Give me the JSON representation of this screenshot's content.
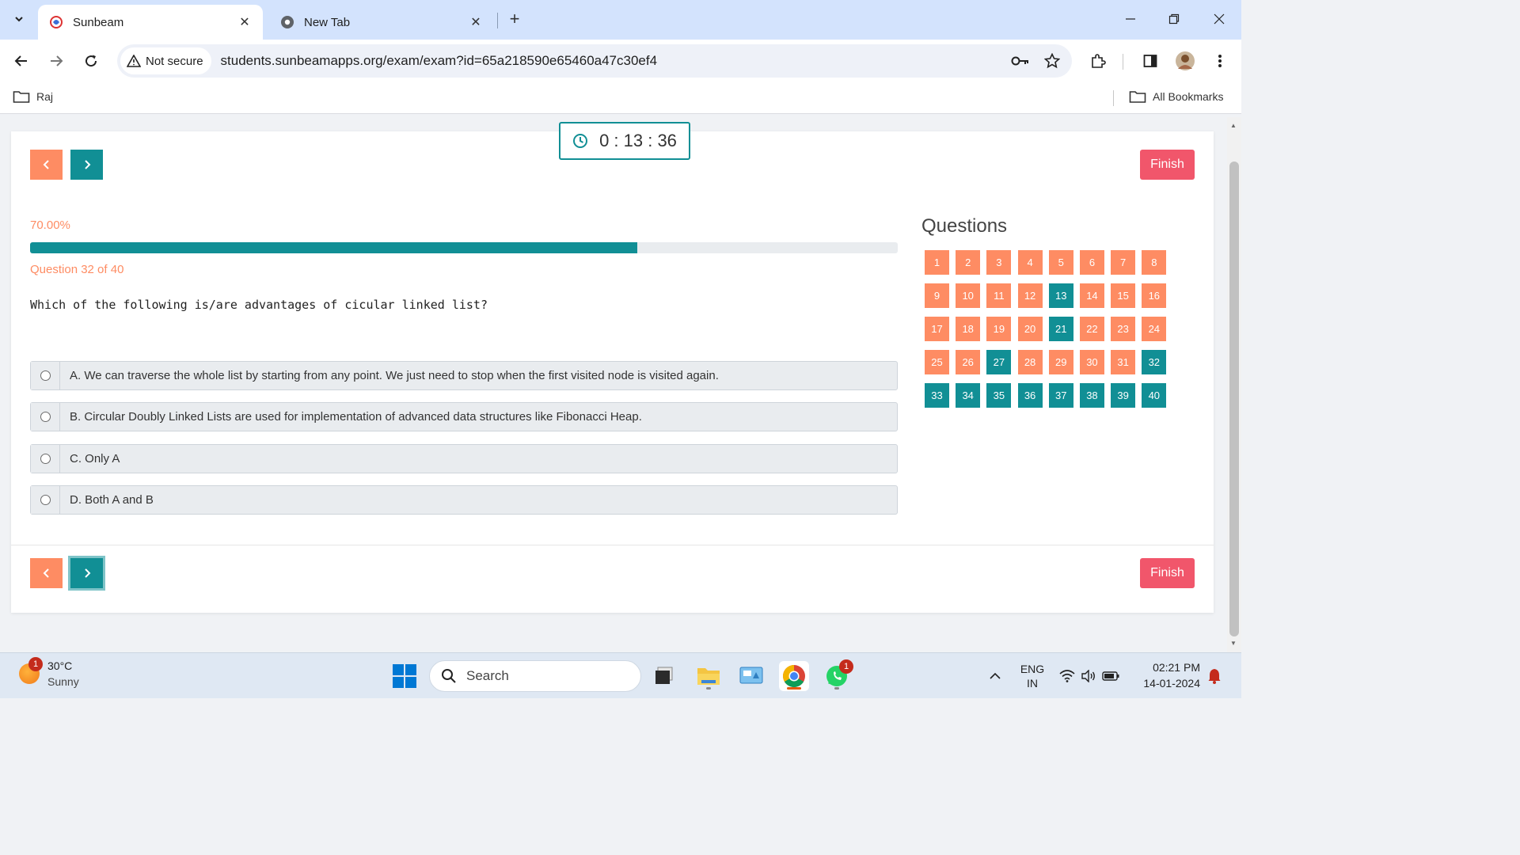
{
  "browser": {
    "tabs": [
      {
        "title": "Sunbeam",
        "active": true
      },
      {
        "title": "New Tab",
        "active": false
      }
    ],
    "security_label": "Not secure",
    "url": "students.sunbeamapps.org/exam/exam?id=65a218590e65460a47c30ef4",
    "bookmarks": {
      "left": "Raj",
      "right": "All Bookmarks"
    }
  },
  "exam": {
    "timer": "0 : 13 : 36",
    "finish_label": "Finish",
    "progress_text": "70.00%",
    "progress_value": 0.7,
    "question_counter": "Question 32 of 40",
    "question_text": "Which of the following is/are advantages of cicular linked list?",
    "options": [
      {
        "text": "A.  We can traverse the whole list by starting from any point. We just need to stop when the first visited node is visited again."
      },
      {
        "text": "B.  Circular Doubly Linked Lists are used for implementation of advanced data structures like Fibonacci Heap."
      },
      {
        "text": "C. Only A"
      },
      {
        "text": "D. Both A and B"
      }
    ],
    "questions_title": "Questions",
    "questions": [
      {
        "n": "1",
        "s": "u"
      },
      {
        "n": "2",
        "s": "u"
      },
      {
        "n": "3",
        "s": "u"
      },
      {
        "n": "4",
        "s": "u"
      },
      {
        "n": "5",
        "s": "u"
      },
      {
        "n": "6",
        "s": "u"
      },
      {
        "n": "7",
        "s": "u"
      },
      {
        "n": "8",
        "s": "u"
      },
      {
        "n": "9",
        "s": "u"
      },
      {
        "n": "10",
        "s": "u"
      },
      {
        "n": "11",
        "s": "u"
      },
      {
        "n": "12",
        "s": "u"
      },
      {
        "n": "13",
        "s": "a"
      },
      {
        "n": "14",
        "s": "u"
      },
      {
        "n": "15",
        "s": "u"
      },
      {
        "n": "16",
        "s": "u"
      },
      {
        "n": "17",
        "s": "u"
      },
      {
        "n": "18",
        "s": "u"
      },
      {
        "n": "19",
        "s": "u"
      },
      {
        "n": "20",
        "s": "u"
      },
      {
        "n": "21",
        "s": "a"
      },
      {
        "n": "22",
        "s": "u"
      },
      {
        "n": "23",
        "s": "u"
      },
      {
        "n": "24",
        "s": "u"
      },
      {
        "n": "25",
        "s": "u"
      },
      {
        "n": "26",
        "s": "u"
      },
      {
        "n": "27",
        "s": "a"
      },
      {
        "n": "28",
        "s": "u"
      },
      {
        "n": "29",
        "s": "u"
      },
      {
        "n": "30",
        "s": "u"
      },
      {
        "n": "31",
        "s": "u"
      },
      {
        "n": "32",
        "s": "a"
      },
      {
        "n": "33",
        "s": "a"
      },
      {
        "n": "34",
        "s": "a"
      },
      {
        "n": "35",
        "s": "a"
      },
      {
        "n": "36",
        "s": "a"
      },
      {
        "n": "37",
        "s": "a"
      },
      {
        "n": "38",
        "s": "a"
      },
      {
        "n": "39",
        "s": "a"
      },
      {
        "n": "40",
        "s": "a"
      }
    ],
    "colors": {
      "accent": "#118f95",
      "unanswered": "#fe8c63",
      "finish": "#f1566b"
    }
  },
  "taskbar": {
    "weather_temp": "30°C",
    "weather_desc": "Sunny",
    "weather_badge": "1",
    "search_placeholder": "Search",
    "whatsapp_badge": "1",
    "lang_top": "ENG",
    "lang_bottom": "IN",
    "time": "02:21 PM",
    "date": "14-01-2024"
  }
}
